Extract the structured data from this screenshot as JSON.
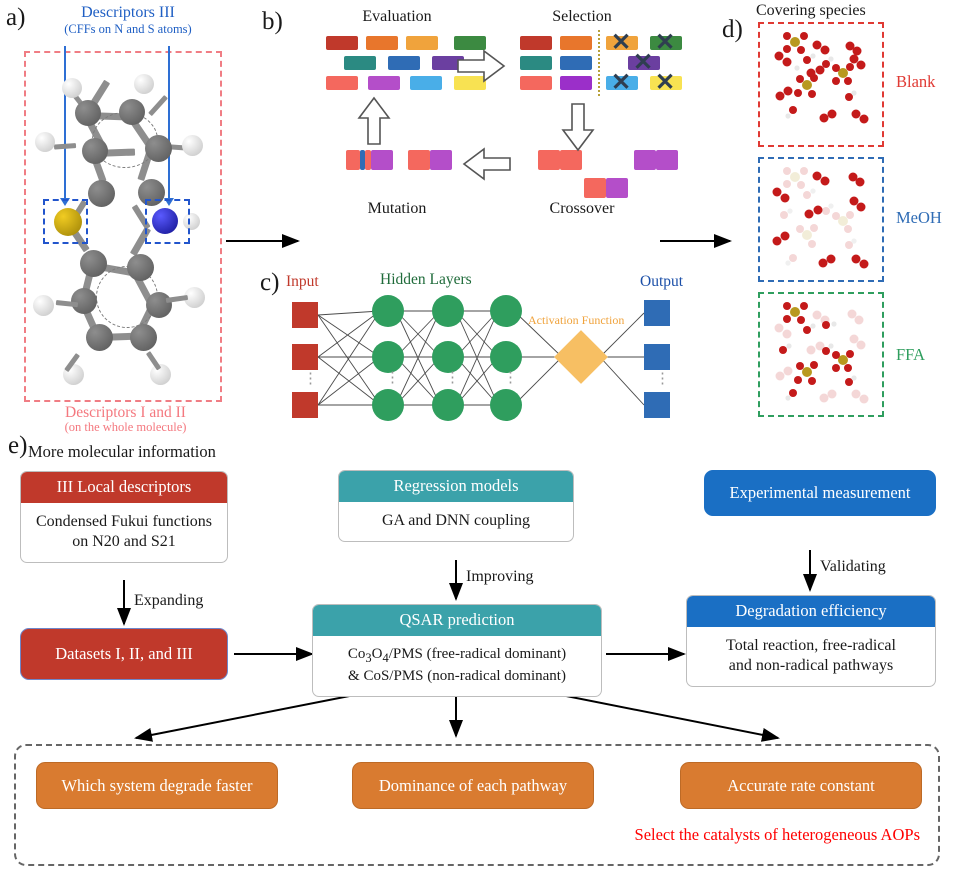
{
  "figure": {
    "panels": [
      "a",
      "b",
      "c",
      "d",
      "e"
    ]
  },
  "panel_a": {
    "letter": "a)",
    "title": "Descriptors III",
    "subtitle": "(CFFs on N and S atoms)",
    "caption": "Descriptors I and II",
    "caption_sub": "(on the whole molecule)",
    "highlight_color": "#2255cc",
    "outer_box_color": "#f07d84",
    "molecule": "phenothiazine ball-and-stick model",
    "highlighted_atoms": [
      "S",
      "N"
    ]
  },
  "panel_b": {
    "letter": "b)",
    "steps": [
      {
        "name": "Evaluation",
        "label": "Evaluation"
      },
      {
        "name": "Selection",
        "label": "Selection"
      },
      {
        "name": "Crossover",
        "label": "Crossover"
      },
      {
        "name": "Mutation",
        "label": "Mutation"
      }
    ],
    "gene_colors": [
      "#c0392b",
      "#e8762c",
      "#f0a33c",
      "#3c8a41",
      "#2b8a82",
      "#2f6cb5",
      "#6b3fa0",
      "#f4685e",
      "#b44ec9",
      "#49aee8",
      "#f8e252"
    ]
  },
  "panel_c": {
    "letter": "c)",
    "input_label": "Input",
    "hidden_label": "Hidden Layers",
    "output_label": "Output",
    "activation_label": "Activation Function",
    "input_color": "#c0392b",
    "hidden_color": "#2f9e5e",
    "output_color": "#2f6cb5",
    "activation_color": "#f7bf63",
    "hidden_layer_count": 3
  },
  "panel_d": {
    "letter": "d)",
    "title": "Covering species",
    "cases": [
      {
        "name": "Blank",
        "label": "Blank",
        "color": "#e03a34"
      },
      {
        "name": "MeOH",
        "label": "MeOH",
        "color": "#2f6cb5"
      },
      {
        "name": "FFA",
        "label": "FFA",
        "color": "#2f9e5e"
      }
    ]
  },
  "panel_e": {
    "letter": "e)",
    "top_label": "More molecular information",
    "nodes": {
      "local_descriptors": {
        "head": "III Local descriptors",
        "body": "Condensed Fukui functions\non N20 and S21",
        "head_color": "#c0392b"
      },
      "regression_models": {
        "head": "Regression models",
        "body": "GA and DNN coupling",
        "head_color": "#3ba2aa"
      },
      "experimental_measurement": {
        "label": "Experimental measurement",
        "color": "#1a6fc4"
      },
      "datasets": {
        "label": "Datasets I, II, and III",
        "color": "#c0392b"
      },
      "qsar_prediction": {
        "head": "QSAR prediction",
        "body_line1": "Co3O4/PMS (free-radical dominant)",
        "body_line2": "& CoS/PMS (non-radical dominant)",
        "head_color": "#3ba2aa"
      },
      "degradation_efficiency": {
        "head": "Degradation efficiency",
        "body": "Total reaction, free-radical\nand non-radical pathways",
        "head_color": "#1a6fc4"
      }
    },
    "edge_labels": {
      "expanding": "Expanding",
      "improving": "Improving",
      "validating": "Validating"
    },
    "outcomes": [
      {
        "name": "which-system-degrade-faster",
        "label": "Which system degrade faster"
      },
      {
        "name": "dominance-of-each-pathway",
        "label": "Dominance of each pathway"
      },
      {
        "name": "accurate-rate-constant",
        "label": "Accurate rate constant"
      }
    ],
    "outcome_color": "#d97b30",
    "footer": "Select the catalysts of heterogeneous AOPs",
    "footer_color": "#ff0000"
  }
}
